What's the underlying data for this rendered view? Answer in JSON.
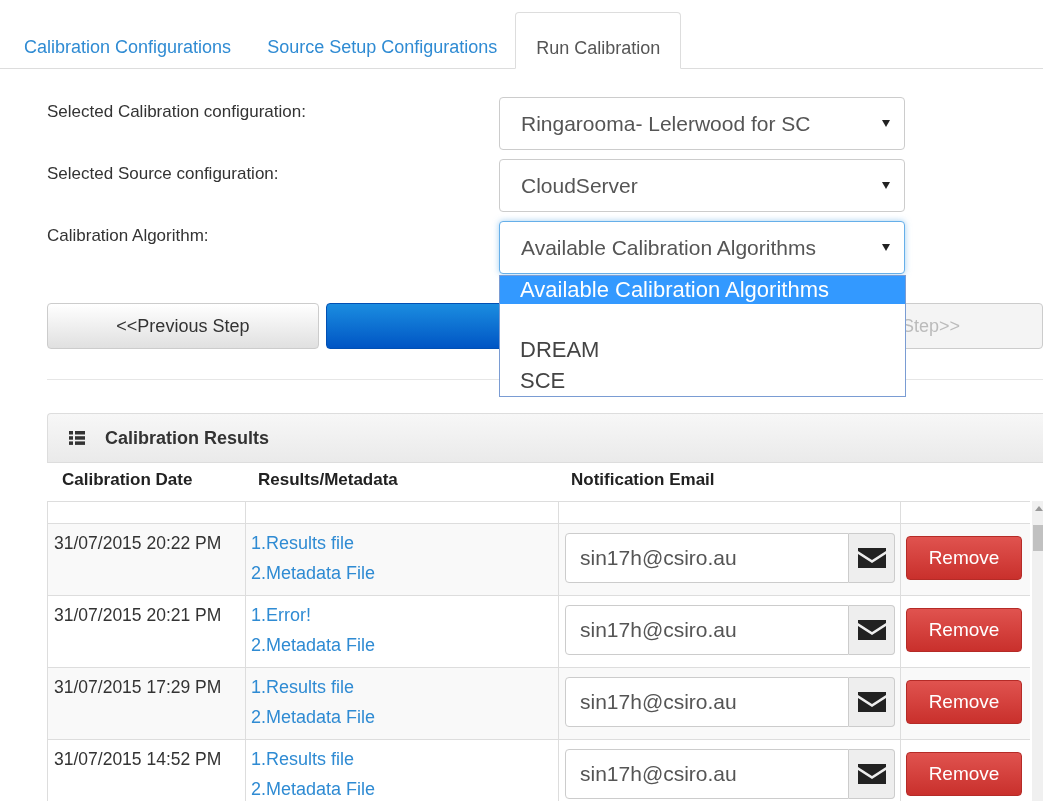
{
  "tabs": [
    {
      "label": "Calibration Configurations",
      "selected": false
    },
    {
      "label": "Source Setup Configurations",
      "selected": false
    },
    {
      "label": "Run Calibration",
      "selected": true
    }
  ],
  "form": [
    {
      "label": "Selected Calibration configuration:",
      "value": "Ringarooma- Lelerwood for SC",
      "focused": false
    },
    {
      "label": "Selected Source configuration:",
      "value": "CloudServer",
      "focused": false
    },
    {
      "label": "Calibration Algorithm:",
      "value": "Available Calibration Algorithms",
      "focused": true
    }
  ],
  "dropdown": {
    "options": [
      {
        "kind": "text",
        "label": "Available Calibration Algorithms",
        "selected": true
      },
      {
        "kind": "text",
        "label": "DREAM",
        "selected": false
      },
      {
        "kind": "text",
        "label": "SCE",
        "selected": false
      }
    ]
  },
  "steps": {
    "previous": "<<Previous Step",
    "next": "Step>>"
  },
  "results": {
    "title": "Calibration Results",
    "columns": [
      "Calibration Date",
      "Results/Metadata",
      "Notification Email"
    ],
    "rows": [
      {
        "date": "31/07/2015 20:22 PM",
        "links": [
          "1.Results file",
          "2.Metadata File"
        ],
        "email": "sin17h@csiro.au",
        "action": "Remove"
      },
      {
        "date": "31/07/2015 20:21 PM",
        "links": [
          "1.Error!",
          "2.Metadata File"
        ],
        "email": "sin17h@csiro.au",
        "action": "Remove"
      },
      {
        "date": "31/07/2015 17:29 PM",
        "links": [
          "1.Results file",
          "2.Metadata File"
        ],
        "email": "sin17h@csiro.au",
        "action": "Remove"
      },
      {
        "date": "31/07/2015 14:52 PM",
        "links": [
          "1.Results file",
          "2.Metadata File"
        ],
        "email": "sin17h@csiro.au",
        "action": "Remove"
      }
    ]
  }
}
